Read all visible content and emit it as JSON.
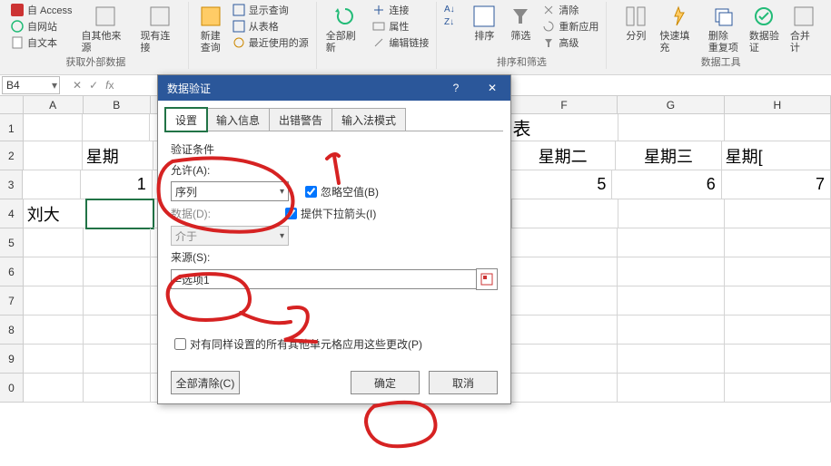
{
  "ribbon": {
    "group1": {
      "label": "获取外部数据",
      "access": "自 Access",
      "web": "自网站",
      "text": "自文本",
      "other": "自其他来源",
      "existing": "现有连接"
    },
    "group2": {
      "new": "新建\n查询",
      "show": "显示查询",
      "table": "从表格",
      "recent": "最近使用的源"
    },
    "group3": {
      "refresh": "全部刷新",
      "conn": "连接",
      "prop": "属性",
      "edit": "编辑链接"
    },
    "group4": {
      "label": "排序和筛选",
      "az": "A→Z",
      "za": "Z→A",
      "sort": "排序",
      "filter": "筛选",
      "clear": "清除",
      "reapply": "重新应用",
      "adv": "高级"
    },
    "group5": {
      "label": "数据工具",
      "split": "分列",
      "flash": "快速填充",
      "dup": "删除\n重复项",
      "valid": "数据验\n证",
      "merge": "合并计"
    }
  },
  "namebox": "B4",
  "sheet": {
    "cols": [
      "A",
      "B",
      "F",
      "G",
      "H"
    ],
    "r1": {
      "F": "表"
    },
    "r2": {
      "B": "星期",
      "F": "星期二",
      "G": "星期三",
      "H": "星期["
    },
    "r3": {
      "B": "1",
      "F": "5",
      "G": "6",
      "H": "7"
    },
    "r4": {
      "A": "刘大"
    }
  },
  "dialog": {
    "title": "数据验证",
    "tabs": [
      "设置",
      "输入信息",
      "出错警告",
      "输入法模式"
    ],
    "cond_label": "验证条件",
    "allow_label": "允许(A):",
    "allow_value": "序列",
    "ignore_blank": "忽略空值(B)",
    "dropdown": "提供下拉箭头(I)",
    "data_label": "数据(D):",
    "data_value": "介于",
    "source_label": "来源(S):",
    "source_value": "=选项1",
    "apply_all": "对有同样设置的所有其他单元格应用这些更改(P)",
    "clear": "全部清除(C)",
    "ok": "确定",
    "cancel": "取消"
  },
  "anno": {
    "one": "1",
    "two": "2"
  }
}
